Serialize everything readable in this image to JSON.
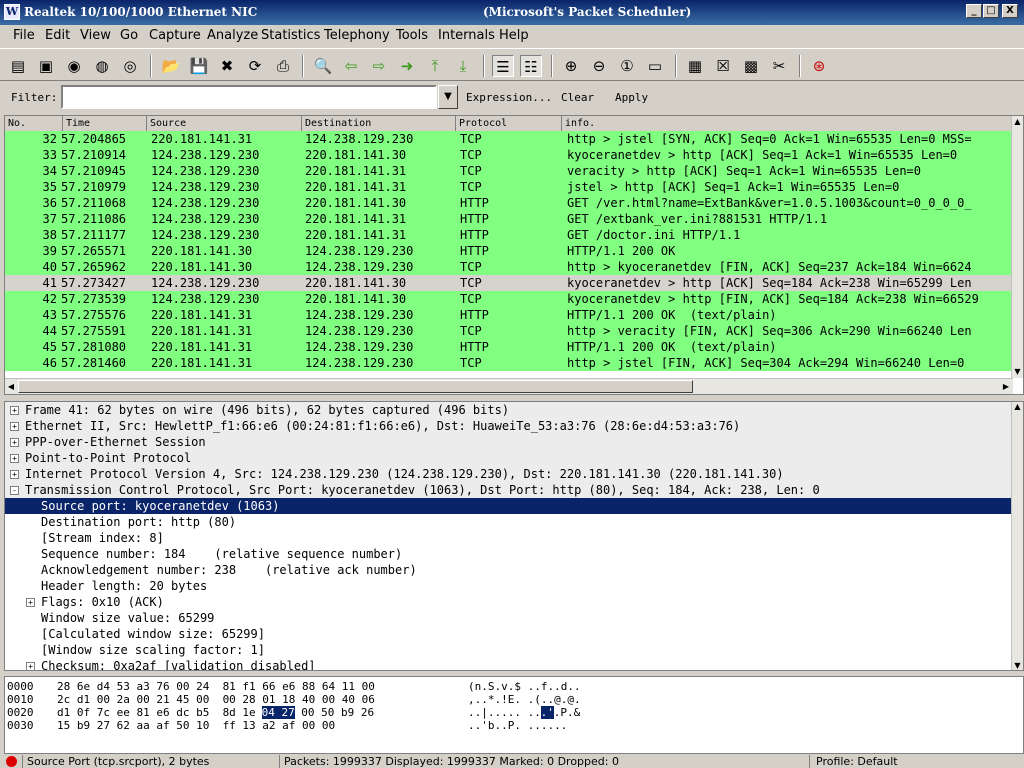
{
  "window": {
    "title_left": "Realtek 10/100/1000 Ethernet NIC",
    "title_right": "(Microsoft's Packet Scheduler)",
    "minimize": "_",
    "maximize": "□",
    "close": "X"
  },
  "menu": [
    "File",
    "Edit",
    "View",
    "Go",
    "Capture",
    "Analyze",
    "Statistics",
    "Telephony",
    "Tools",
    "Internals",
    "Help"
  ],
  "filter": {
    "label": "Filter:",
    "value": "",
    "expression": "Expression...",
    "clear": "Clear",
    "apply": "Apply"
  },
  "packet_list": {
    "columns": [
      "No.",
      "Time",
      "Source",
      "Destination",
      "Protocol",
      "info."
    ],
    "rows": [
      {
        "no": "32",
        "time": "57.204865",
        "src": "220.181.141.31",
        "dst": "124.238.129.230",
        "proto": "TCP",
        "info": "http > jstel [SYN, ACK] Seq=0 Ack=1 Win=65535 Len=0 MSS="
      },
      {
        "no": "33",
        "time": "57.210914",
        "src": "124.238.129.230",
        "dst": "220.181.141.30",
        "proto": "TCP",
        "info": "kyoceranetdev > http [ACK] Seq=1 Ack=1 Win=65535 Len=0"
      },
      {
        "no": "34",
        "time": "57.210945",
        "src": "124.238.129.230",
        "dst": "220.181.141.31",
        "proto": "TCP",
        "info": "veracity > http [ACK] Seq=1 Ack=1 Win=65535 Len=0"
      },
      {
        "no": "35",
        "time": "57.210979",
        "src": "124.238.129.230",
        "dst": "220.181.141.31",
        "proto": "TCP",
        "info": "jstel > http [ACK] Seq=1 Ack=1 Win=65535 Len=0"
      },
      {
        "no": "36",
        "time": "57.211068",
        "src": "124.238.129.230",
        "dst": "220.181.141.30",
        "proto": "HTTP",
        "info": "GET /ver.html?name=ExtBank&ver=1.0.5.1003&count=0_0_0_0_"
      },
      {
        "no": "37",
        "time": "57.211086",
        "src": "124.238.129.230",
        "dst": "220.181.141.31",
        "proto": "HTTP",
        "info": "GET /extbank_ver.ini?881531 HTTP/1.1"
      },
      {
        "no": "38",
        "time": "57.211177",
        "src": "124.238.129.230",
        "dst": "220.181.141.31",
        "proto": "HTTP",
        "info": "GET /doctor.ini HTTP/1.1"
      },
      {
        "no": "39",
        "time": "57.265571",
        "src": "220.181.141.30",
        "dst": "124.238.129.230",
        "proto": "HTTP",
        "info": "HTTP/1.1 200 OK"
      },
      {
        "no": "40",
        "time": "57.265962",
        "src": "220.181.141.30",
        "dst": "124.238.129.230",
        "proto": "TCP",
        "info": "http > kyoceranetdev [FIN, ACK] Seq=237 Ack=184 Win=6624"
      },
      {
        "no": "41",
        "time": "57.273427",
        "src": "124.238.129.230",
        "dst": "220.181.141.30",
        "proto": "TCP",
        "info": "kyoceranetdev > http [ACK] Seq=184 Ack=238 Win=65299 Len"
      },
      {
        "no": "42",
        "time": "57.273539",
        "src": "124.238.129.230",
        "dst": "220.181.141.30",
        "proto": "TCP",
        "info": "kyoceranetdev > http [FIN, ACK] Seq=184 Ack=238 Win=66529"
      },
      {
        "no": "43",
        "time": "57.275576",
        "src": "220.181.141.31",
        "dst": "124.238.129.230",
        "proto": "HTTP",
        "info": "HTTP/1.1 200 OK  (text/plain)"
      },
      {
        "no": "44",
        "time": "57.275591",
        "src": "220.181.141.31",
        "dst": "124.238.129.230",
        "proto": "TCP",
        "info": "http > veracity [FIN, ACK] Seq=306 Ack=290 Win=66240 Len"
      },
      {
        "no": "45",
        "time": "57.281080",
        "src": "220.181.141.31",
        "dst": "124.238.129.230",
        "proto": "HTTP",
        "info": "HTTP/1.1 200 OK  (text/plain)"
      },
      {
        "no": "46",
        "time": "57.281460",
        "src": "220.181.141.31",
        "dst": "124.238.129.230",
        "proto": "TCP",
        "info": "http > jstel [FIN, ACK] Seq=304 Ack=294 Win=66240 Len=0"
      }
    ]
  },
  "details": [
    {
      "text": "Frame 41: 62 bytes on wire (496 bits), 62 bytes captured (496 bits)",
      "exp": "+",
      "indent": 0
    },
    {
      "text": "Ethernet II, Src: HewlettP_f1:66:e6 (00:24:81:f1:66:e6), Dst: HuaweiTe_53:a3:76 (28:6e:d4:53:a3:76)",
      "exp": "+",
      "indent": 0
    },
    {
      "text": "PPP-over-Ethernet Session",
      "exp": "+",
      "indent": 0
    },
    {
      "text": "Point-to-Point Protocol",
      "exp": "+",
      "indent": 0
    },
    {
      "text": "Internet Protocol Version 4, Src: 124.238.129.230 (124.238.129.230), Dst: 220.181.141.30 (220.181.141.30)",
      "exp": "+",
      "indent": 0
    },
    {
      "text": "Transmission Control Protocol, Src Port: kyoceranetdev (1063), Dst Port: http (80), Seq: 184, Ack: 238, Len: 0",
      "exp": "-",
      "indent": 0
    },
    {
      "text": "Source port: kyoceranetdev (1063)",
      "exp": "",
      "indent": 1
    },
    {
      "text": "Destination port: http (80)",
      "exp": "",
      "indent": 1
    },
    {
      "text": "[Stream index: 8]",
      "exp": "",
      "indent": 1
    },
    {
      "text": "Sequence number: 184    (relative sequence number)",
      "exp": "",
      "indent": 1
    },
    {
      "text": "Acknowledgement number: 238    (relative ack number)",
      "exp": "",
      "indent": 1
    },
    {
      "text": "Header length: 20 bytes",
      "exp": "",
      "indent": 1
    },
    {
      "text": "Flags: 0x10 (ACK)",
      "exp": "+",
      "indent": 1
    },
    {
      "text": "Window size value: 65299",
      "exp": "",
      "indent": 1
    },
    {
      "text": "[Calculated window size: 65299]",
      "exp": "",
      "indent": 1
    },
    {
      "text": "[Window size scaling factor: 1]",
      "exp": "",
      "indent": 1
    },
    {
      "text": "Checksum: 0xa2af [validation disabled]",
      "exp": "+",
      "indent": 1
    }
  ],
  "hex": [
    {
      "off": "0000",
      "bytes_a": "28 6e d4 53 a3 76 00 24  81 f1 66 e6 88 64 11 00",
      "bytes_hl": "",
      "bytes_b": "",
      "ascii_a": "(n.S.v.$ ..f..d..",
      "ascii_hl": "",
      "ascii_b": ""
    },
    {
      "off": "0010",
      "bytes_a": "2c d1 00 2a 00 21 45 00  00 28 01 18 40 00 40 06",
      "bytes_hl": "",
      "bytes_b": "",
      "ascii_a": ",..*.!E. .(..@.@.",
      "ascii_hl": "",
      "ascii_b": ""
    },
    {
      "off": "0020",
      "bytes_a": "d1 0f 7c ee 81 e6 dc b5  8d 1e ",
      "bytes_hl": "04 27",
      "bytes_b": " 00 50 b9 26",
      "ascii_a": "..|..... ..",
      "ascii_hl": ".'",
      "ascii_b": ".P.&"
    },
    {
      "off": "0030",
      "bytes_a": "15 b9 27 62 aa af 50 10  ff 13 a2 af 00 00",
      "bytes_hl": "",
      "bytes_b": "",
      "ascii_a": "..'b..P. ......",
      "ascii_hl": "",
      "ascii_b": ""
    }
  ],
  "status": {
    "field": "Source Port (tcp.srcport), 2 bytes",
    "packets": "Packets: 1999337 Displayed: 1999337 Marked: 0 Dropped: 0",
    "profile": "Profile: Default"
  },
  "colors": {
    "tcp_row": "#80ff80",
    "selected_row": "#d6d3ce",
    "selected_detail": "#0a246a"
  }
}
